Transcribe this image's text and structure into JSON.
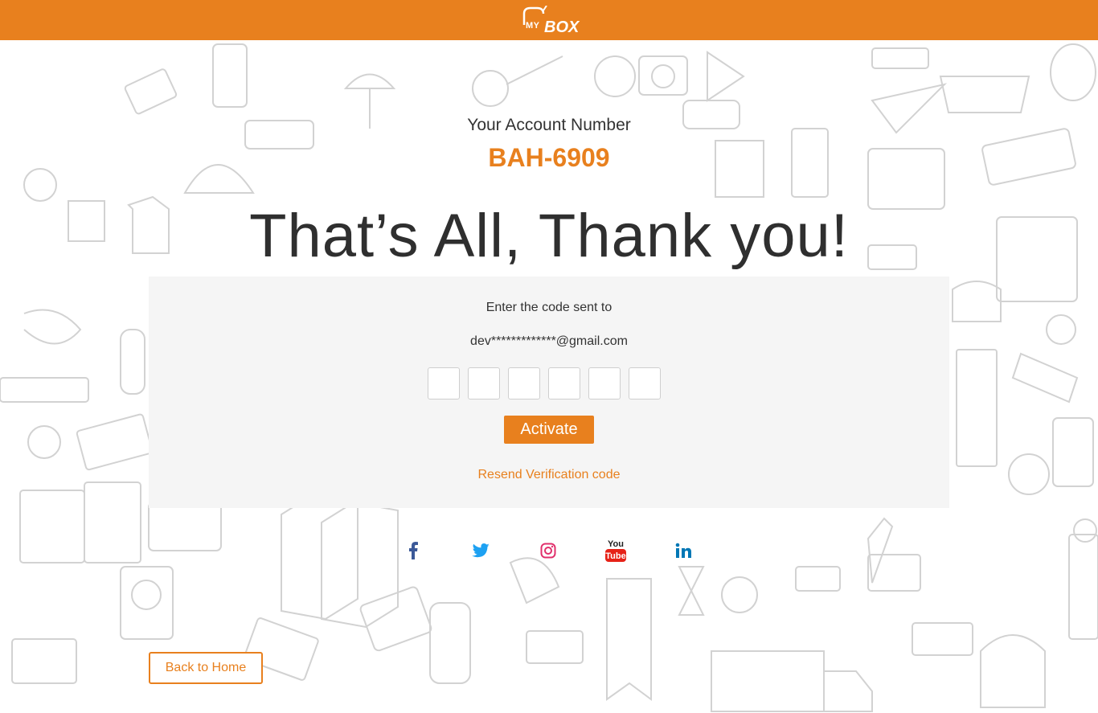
{
  "header": {
    "logo_my": "MY",
    "logo_box": "BOX",
    "brand_color": "#e8801e"
  },
  "account": {
    "label": "Your Account Number",
    "number": "BAH-6909"
  },
  "headline": "That’s All, Thank you!",
  "verification": {
    "prompt": "Enter the code sent to",
    "email": "dev*************@gmail.com",
    "code_digits": 6,
    "activate_label": "Activate",
    "resend_label": "Resend Verification code"
  },
  "social": [
    {
      "name": "facebook-icon",
      "color": "#3b5998"
    },
    {
      "name": "twitter-icon",
      "color": "#1da1f2"
    },
    {
      "name": "instagram-icon",
      "color": "#e1306c"
    },
    {
      "name": "youtube-icon",
      "color": "#e62117"
    },
    {
      "name": "linkedin-icon",
      "color": "#0077b5"
    }
  ],
  "youtube_you": "You",
  "youtube_tube": "Tube",
  "back_label": "Back to Home"
}
